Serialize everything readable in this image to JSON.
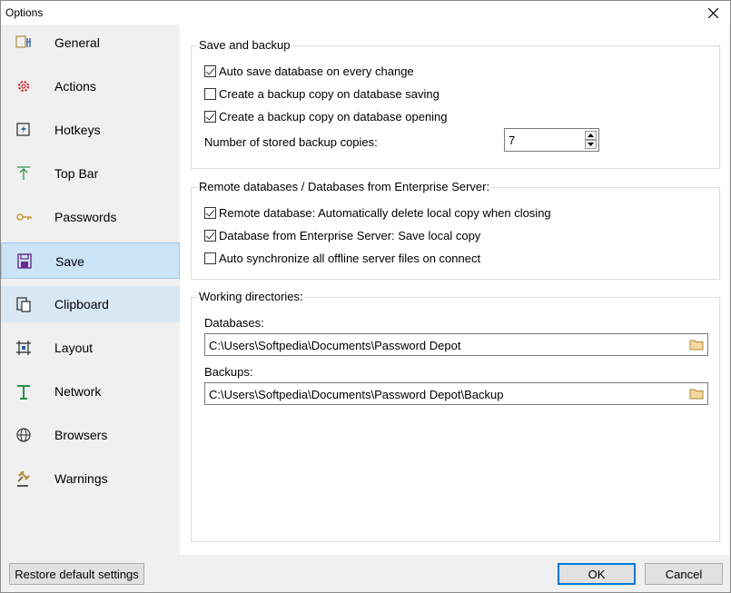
{
  "window": {
    "title": "Options"
  },
  "sidebar": {
    "items": [
      {
        "label": "General",
        "icon": "general-icon"
      },
      {
        "label": "Actions",
        "icon": "gear-icon"
      },
      {
        "label": "Hotkeys",
        "icon": "hotkey-icon"
      },
      {
        "label": "Top Bar",
        "icon": "topbar-icon"
      },
      {
        "label": "Passwords",
        "icon": "key-icon"
      },
      {
        "label": "Save",
        "icon": "floppy-icon",
        "selected": true
      },
      {
        "label": "Clipboard",
        "icon": "clipboard-icon"
      },
      {
        "label": "Layout",
        "icon": "layout-icon"
      },
      {
        "label": "Network",
        "icon": "network-icon"
      },
      {
        "label": "Browsers",
        "icon": "globe-icon"
      },
      {
        "label": "Warnings",
        "icon": "gavel-icon"
      }
    ]
  },
  "save_backup": {
    "title": "Save and backup",
    "options": [
      {
        "label": "Auto save database on every change",
        "checked": true
      },
      {
        "label": "Create a backup copy on database saving",
        "checked": false
      },
      {
        "label": "Create a backup copy on database opening",
        "checked": true
      }
    ],
    "copies_label": "Number of stored backup copies:",
    "copies_value": "7"
  },
  "remote": {
    "title": "Remote databases / Databases from Enterprise Server:",
    "options": [
      {
        "label": "Remote database: Automatically delete local copy when closing",
        "checked": true
      },
      {
        "label": "Database from Enterprise Server: Save local copy",
        "checked": true
      },
      {
        "label": "Auto synchronize all offline server files on connect",
        "checked": false
      }
    ]
  },
  "directories": {
    "title": "Working directories:",
    "databases_label": "Databases:",
    "databases_path": "C:\\Users\\Softpedia\\Documents\\Password Depot",
    "backups_label": "Backups:",
    "backups_path": "C:\\Users\\Softpedia\\Documents\\Password Depot\\Backup"
  },
  "footer": {
    "restore_label": "Restore default settings",
    "ok_label": "OK",
    "cancel_label": "Cancel"
  },
  "colors": {
    "selection": "#cce4f7",
    "accent": "#0078d7"
  }
}
